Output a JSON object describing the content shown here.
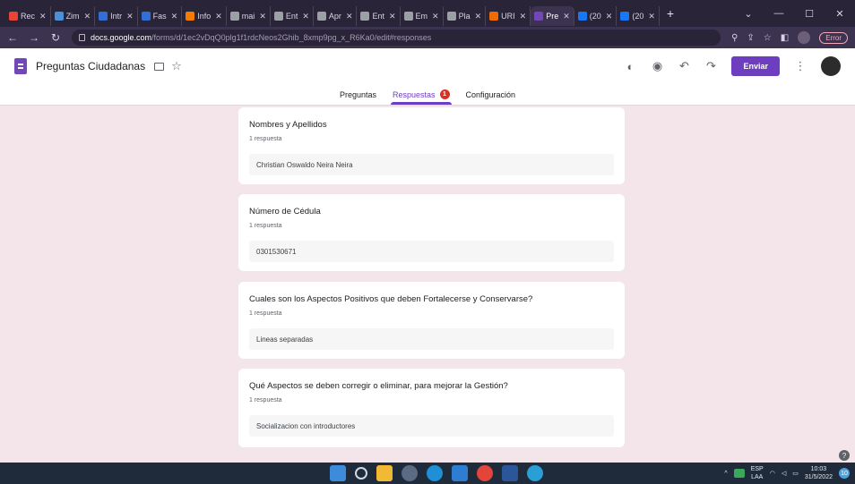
{
  "browser": {
    "tabs": [
      {
        "label": "Rec",
        "color": "#ea4335"
      },
      {
        "label": "Zim",
        "color": "#4a90d9"
      },
      {
        "label": "Intr",
        "color": "#2f6fd6"
      },
      {
        "label": "Fas",
        "color": "#2f6fd6"
      },
      {
        "label": "Info",
        "color": "#f57c00"
      },
      {
        "label": "mai",
        "color": "#9aa0a6"
      },
      {
        "label": "Ent",
        "color": "#9aa0a6"
      },
      {
        "label": "Apr",
        "color": "#9aa0a6"
      },
      {
        "label": "Ent",
        "color": "#9aa0a6"
      },
      {
        "label": "Em",
        "color": "#9aa0a6"
      },
      {
        "label": "Pla",
        "color": "#9aa0a6"
      },
      {
        "label": "URI",
        "color": "#ef6c00"
      },
      {
        "label": "Pre",
        "color": "#7248b9"
      },
      {
        "label": "(20",
        "color": "#1877f2"
      },
      {
        "label": "(20",
        "color": "#1877f2"
      }
    ],
    "new_tab": "+",
    "url_host": "docs.google.com",
    "url_path": "/forms/d/1ec2vDqQ0plg1f1rdcNeos2Ghib_8xmp9pg_x_R6Ka0/edit#responses",
    "error_label": "Error"
  },
  "form": {
    "title": "Preguntas Ciudadanas",
    "send_label": "Enviar",
    "tabs": {
      "questions": "Preguntas",
      "responses": "Respuestas",
      "responses_badge": "1",
      "settings": "Configuración"
    },
    "cards": [
      {
        "title": "Nombres y Apellidos",
        "count": "1 respuesta",
        "answer": "Christian Oswaldo Neira Neira"
      },
      {
        "title": "Número de Cédula",
        "count": "1 respuesta",
        "answer": "0301530671"
      },
      {
        "title": "Cuales son los Aspectos Positivos que deben Fortalecerse y Conservarse?",
        "count": "1 respuesta",
        "answer": "Lineas separadas"
      },
      {
        "title": "Qué Aspectos se deben corregir o eliminar, para mejorar la Gestión?",
        "count": "1 respuesta",
        "answer": "Socializacion con introductores"
      }
    ]
  },
  "taskbar": {
    "lang_top": "ESP",
    "lang_bottom": "LAA",
    "time": "10:03",
    "date": "31/5/2022",
    "notifications": "10"
  },
  "colors": {
    "accent": "#6d3fc0",
    "page_bg": "#f3e5ea",
    "badge": "#d93025"
  }
}
